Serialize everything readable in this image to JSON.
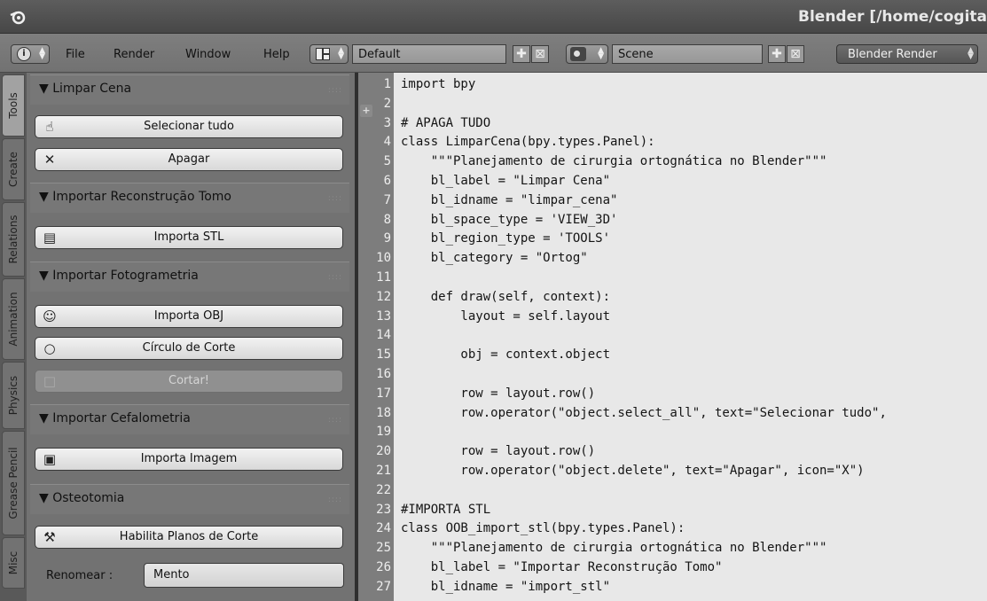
{
  "window": {
    "title": "Blender [/home/cogita"
  },
  "header": {
    "menus": [
      "File",
      "Render",
      "Window",
      "Help"
    ],
    "layout_name": "Default",
    "scene_name": "Scene",
    "render_engine": "Blender Render",
    "add_icon": "✚",
    "remove_icon": "⊠"
  },
  "tabs": [
    "Tools",
    "Create",
    "Relations",
    "Animation",
    "Physics",
    "Grease Pencil",
    "Misc"
  ],
  "panels": [
    {
      "label": "▼ Limpar Cena",
      "buttons": [
        {
          "label": "Selecionar tudo",
          "icon": "hand-pointer-icon",
          "glyph": "☝",
          "enabled": true
        },
        {
          "label": "Apagar",
          "icon": "x-icon",
          "glyph": "✕",
          "enabled": true
        }
      ]
    },
    {
      "label": "▼ Importar Reconstrução Tomo",
      "buttons": [
        {
          "label": "Importa STL",
          "icon": "file-import-icon",
          "glyph": "▤",
          "enabled": true
        }
      ]
    },
    {
      "label": "▼ Importar Fotogrametria",
      "buttons": [
        {
          "label": "Importa OBJ",
          "icon": "monkey-icon",
          "glyph": "☺",
          "enabled": true
        },
        {
          "label": "Círculo de Corte",
          "icon": "circle-icon",
          "glyph": "○",
          "enabled": true
        },
        {
          "label": "Cortar!",
          "icon": "square-icon",
          "glyph": "□",
          "enabled": false
        }
      ]
    },
    {
      "label": "▼ Importar Cefalometria",
      "buttons": [
        {
          "label": "Importa Imagem",
          "icon": "image-icon",
          "glyph": "▣",
          "enabled": true
        }
      ]
    },
    {
      "label": "▼ Osteotomia",
      "buttons": [
        {
          "label": "Habilita Planos de Corte",
          "icon": "wrench-icon",
          "glyph": "⚒",
          "enabled": true
        }
      ]
    }
  ],
  "rename": {
    "label": "Renomear :",
    "value": "Mento"
  },
  "code_lines": [
    "import bpy",
    "",
    "# APAGA TUDO",
    "class LimparCena(bpy.types.Panel):",
    "    \"\"\"Planejamento de cirurgia ortognática no Blender\"\"\"",
    "    bl_label = \"Limpar Cena\"",
    "    bl_idname = \"limpar_cena\"",
    "    bl_space_type = 'VIEW_3D'",
    "    bl_region_type = 'TOOLS'",
    "    bl_category = \"Ortog\"",
    "",
    "    def draw(self, context):",
    "        layout = self.layout",
    "",
    "        obj = context.object",
    "",
    "        row = layout.row()",
    "        row.operator(\"object.select_all\", text=\"Selecionar tudo\",",
    "",
    "        row = layout.row()",
    "        row.operator(\"object.delete\", text=\"Apagar\", icon=\"X\")",
    "",
    "#IMPORTA STL",
    "class OOB_import_stl(bpy.types.Panel):",
    "    \"\"\"Planejamento de cirurgia ortognática no Blender\"\"\"",
    "    bl_label = \"Importar Reconstrução Tomo\"",
    "    bl_idname = \"import_stl\""
  ]
}
